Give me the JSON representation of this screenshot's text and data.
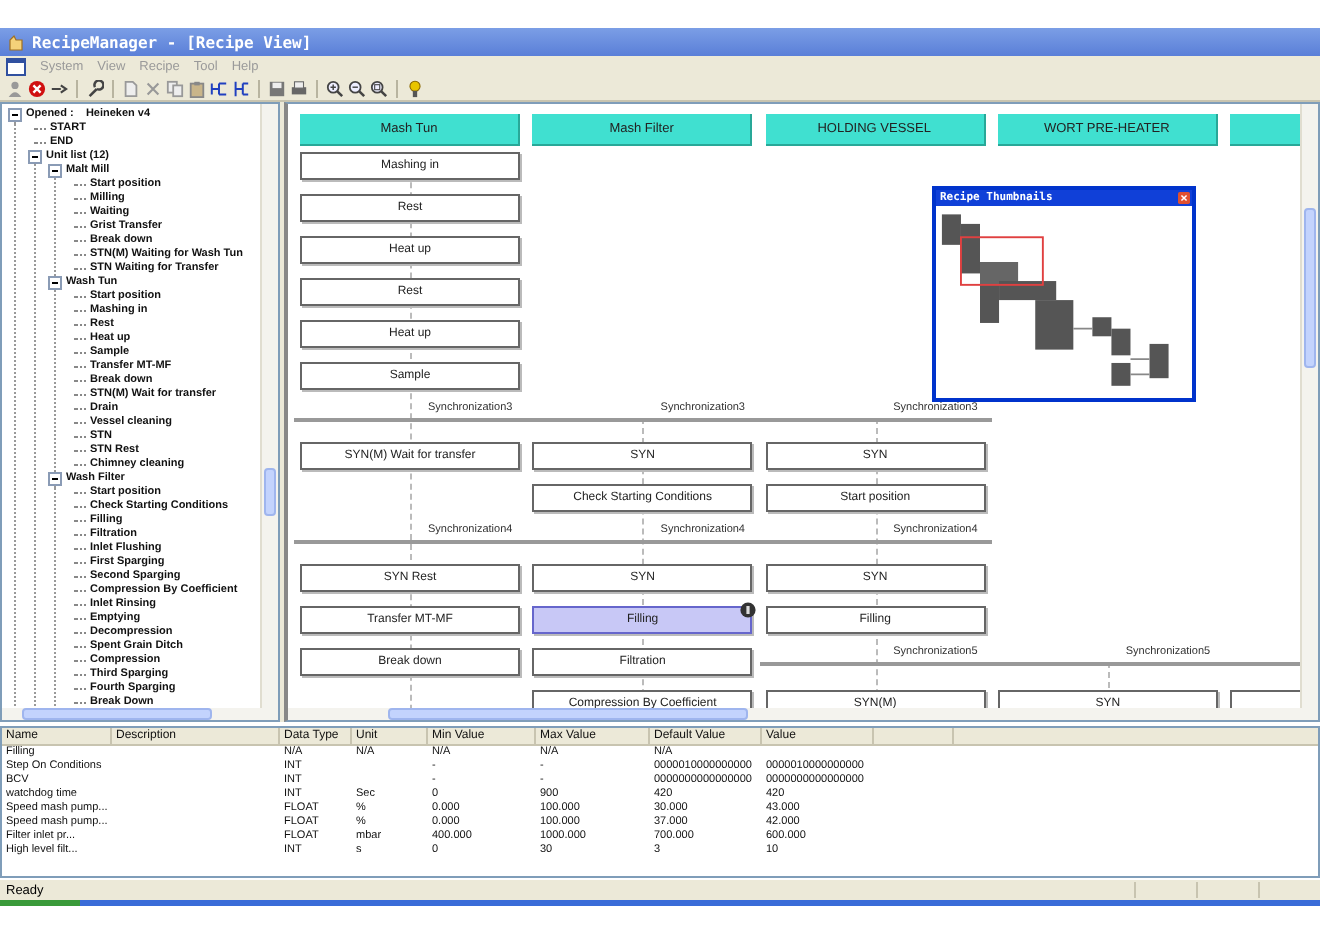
{
  "window": {
    "title": "RecipeManager - [Recipe View]"
  },
  "menu": [
    {
      "label": "System",
      "disabled": true
    },
    {
      "label": "View",
      "disabled": true
    },
    {
      "label": "Recipe",
      "disabled": true
    },
    {
      "label": "Tool",
      "disabled": true
    },
    {
      "label": "Help",
      "disabled": true
    }
  ],
  "tree": [
    {
      "label": "Opened :    Heineken v4",
      "expanded": true,
      "children": [
        {
          "label": "START"
        },
        {
          "label": "END"
        },
        {
          "label": "Unit list (12)",
          "expanded": true,
          "children": [
            {
              "label": "Malt Mill",
              "expanded": true,
              "children": [
                {
                  "label": "Start position"
                },
                {
                  "label": "Milling"
                },
                {
                  "label": "Waiting"
                },
                {
                  "label": "Grist Transfer"
                },
                {
                  "label": "Break down"
                },
                {
                  "label": "STN(M) Waiting for Wash Tun"
                },
                {
                  "label": "STN Waiting for Transfer"
                }
              ]
            },
            {
              "label": "Wash Tun",
              "expanded": true,
              "children": [
                {
                  "label": "Start position"
                },
                {
                  "label": "Mashing in"
                },
                {
                  "label": "Rest"
                },
                {
                  "label": "Heat up"
                },
                {
                  "label": "Sample"
                },
                {
                  "label": "Transfer MT-MF"
                },
                {
                  "label": "Break down"
                },
                {
                  "label": "STN(M) Wait for transfer"
                },
                {
                  "label": "Drain"
                },
                {
                  "label": "Vessel cleaning"
                },
                {
                  "label": "STN"
                },
                {
                  "label": "STN Rest"
                },
                {
                  "label": "Chimney cleaning"
                }
              ]
            },
            {
              "label": "Wash Filter",
              "expanded": true,
              "children": [
                {
                  "label": "Start position"
                },
                {
                  "label": "Check Starting Conditions"
                },
                {
                  "label": "Filling"
                },
                {
                  "label": "Filtration"
                },
                {
                  "label": "Inlet Flushing"
                },
                {
                  "label": "First Sparging"
                },
                {
                  "label": "Second Sparging"
                },
                {
                  "label": "Compression By Coefficient"
                },
                {
                  "label": "Inlet Rinsing"
                },
                {
                  "label": "Emptying"
                },
                {
                  "label": "Decompression"
                },
                {
                  "label": "Spent Grain Ditch"
                },
                {
                  "label": "Compression"
                },
                {
                  "label": "Third Sparging"
                },
                {
                  "label": "Fourth Sparging"
                },
                {
                  "label": "Break Down"
                }
              ]
            }
          ]
        }
      ]
    }
  ],
  "lanes": [
    {
      "label": "Mash Tun"
    },
    {
      "label": "Mash Filter"
    },
    {
      "label": "HOLDING VESSEL"
    },
    {
      "label": "WORT PRE-HEATER"
    }
  ],
  "lanes_continue": true,
  "rows": [
    {
      "kind": "steps",
      "cells": [
        {
          "label": "Mashing in",
          "selected": false
        }
      ]
    },
    {
      "kind": "steps",
      "cells": [
        {
          "label": "Rest",
          "selected": false
        }
      ]
    },
    {
      "kind": "steps",
      "cells": [
        {
          "label": "Heat up",
          "selected": false
        }
      ]
    },
    {
      "kind": "steps",
      "cells": [
        {
          "label": "Rest",
          "selected": false
        }
      ]
    },
    {
      "kind": "steps",
      "cells": [
        {
          "label": "Heat up",
          "selected": false
        }
      ]
    },
    {
      "kind": "steps",
      "cells": [
        {
          "label": "Sample",
          "selected": false
        }
      ]
    },
    {
      "kind": "sync",
      "sync": {
        "lanes": [
          {
            "on": true,
            "label": "Synchronization3"
          },
          {
            "on": true,
            "label": "Synchronization3"
          },
          {
            "on": true,
            "label": "Synchronization3"
          }
        ],
        "continues": false
      }
    },
    {
      "kind": "steps",
      "cells": [
        {
          "label": "SYN(M) Wait for transfer",
          "selected": false
        },
        {
          "label": "SYN",
          "selected": false
        },
        {
          "label": "SYN",
          "selected": false
        }
      ]
    },
    {
      "kind": "steps",
      "cells": [
        null,
        {
          "label": "Check Starting Conditions",
          "selected": false
        },
        {
          "label": "Start position",
          "selected": false
        }
      ]
    },
    {
      "kind": "sync",
      "sync": {
        "lanes": [
          {
            "on": true,
            "label": "Synchronization4"
          },
          {
            "on": true,
            "label": "Synchronization4"
          },
          {
            "on": true,
            "label": "Synchronization4"
          }
        ],
        "continues": false
      }
    },
    {
      "kind": "steps",
      "cells": [
        {
          "label": "SYN Rest",
          "selected": false
        },
        {
          "label": "SYN",
          "selected": false
        },
        {
          "label": "SYN",
          "selected": false
        }
      ]
    },
    {
      "kind": "steps",
      "cells": [
        {
          "label": "Transfer MT-MF",
          "selected": false
        },
        {
          "label": "Filling",
          "selected": true,
          "marker": true
        },
        {
          "label": "Filling",
          "selected": false
        }
      ]
    },
    {
      "kind": "steps",
      "cells": [
        {
          "label": "Break down",
          "selected": false
        },
        {
          "label": "Filtration",
          "selected": false
        }
      ],
      "sync": {
        "lanes": [
          {
            "on": false
          },
          {
            "on": false
          },
          {
            "on": true,
            "label": "Synchronization5"
          },
          {
            "on": true,
            "label": "Synchronization5"
          }
        ],
        "continues": true
      }
    },
    {
      "kind": "steps",
      "cells": [
        null,
        {
          "label": "Compression By Coefficient",
          "selected": false
        },
        {
          "label": "SYN(M)",
          "selected": false
        },
        {
          "label": "SYN",
          "selected": false
        },
        {
          "selected": false
        }
      ]
    }
  ],
  "thumbnail": {
    "title": "Recipe Thumbnails"
  },
  "table": {
    "columns": [
      "Name",
      "Description",
      "Data Type",
      "Unit",
      "Min Value",
      "Max Value",
      "Default Value",
      "Value"
    ],
    "rows": [
      [
        "Filling",
        null,
        "N/A",
        "N/A",
        "N/A",
        "N/A",
        "N/A",
        null
      ],
      [
        "Step On Conditions",
        null,
        "INT",
        null,
        "-",
        "-",
        "0000010000000000",
        "0000010000000000"
      ],
      [
        "BCV",
        null,
        "INT",
        null,
        "-",
        "-",
        "0000000000000000",
        "0000000000000000"
      ],
      [
        "watchdog time",
        null,
        "INT",
        "Sec",
        "0",
        "900",
        "420",
        "420"
      ],
      [
        "Speed mash pump...",
        null,
        "FLOAT",
        "%",
        "0.000",
        "100.000",
        "30.000",
        "43.000"
      ],
      [
        "Speed mash pump...",
        null,
        "FLOAT",
        "%",
        "0.000",
        "100.000",
        "37.000",
        "42.000"
      ],
      [
        "Filter inlet pr...",
        null,
        "FLOAT",
        "mbar",
        "400.000",
        "1000.000",
        "700.000",
        "600.000"
      ],
      [
        "High level filt...",
        null,
        "INT",
        "s",
        "0",
        "30",
        "3",
        "10"
      ]
    ]
  },
  "status_bar": "Ready"
}
